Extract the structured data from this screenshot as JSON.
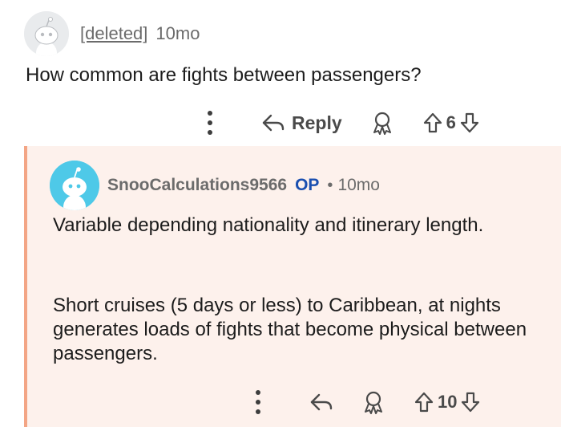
{
  "comment": {
    "author": "[deleted]",
    "time": "10mo",
    "body": "How common are fights between passengers?",
    "actions": {
      "reply_label": "Reply",
      "score": "6"
    }
  },
  "reply": {
    "author": "SnooCalculations9566",
    "op_badge": "OP",
    "separator": "•",
    "time": "10mo",
    "paragraphs": [
      "Variable depending nationality and itinerary length.",
      "Short cruises (5 days or less) to Caribbean, at nights generates loads of fights that become physical between passengers."
    ],
    "actions": {
      "score": "10"
    }
  },
  "colors": {
    "thread_background": "#fdf1ec",
    "thread_border": "#f3a585",
    "op_badge": "#1a4fb0",
    "avatar_teal": "#4ec9e8"
  },
  "icons": [
    "snoo-avatar-icon",
    "more-options-icon",
    "reply-arrow-icon",
    "award-icon",
    "upvote-icon",
    "downvote-icon"
  ]
}
